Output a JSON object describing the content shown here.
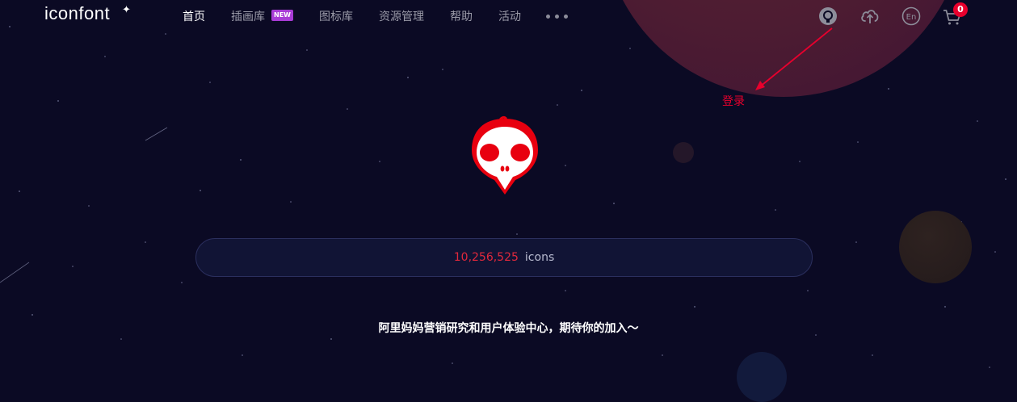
{
  "brand": {
    "logo_text": "iconfont",
    "logo_mark": "✦"
  },
  "nav": {
    "items": [
      {
        "label": "首页"
      },
      {
        "label": "插画库"
      },
      {
        "label": "图标库"
      },
      {
        "label": "资源管理"
      },
      {
        "label": "帮助"
      },
      {
        "label": "活动"
      }
    ],
    "new_badge": "NEW",
    "more_icon": "more-dots-icon"
  },
  "header_actions": {
    "icons": [
      "github-icon",
      "upload-cloud-icon",
      "language-en-icon",
      "cart-icon"
    ],
    "language_label": "En",
    "cart_count": "0"
  },
  "annotation": {
    "login_label": "登录"
  },
  "hero": {
    "icon_count": "10,256,525",
    "icon_unit": "icons",
    "tagline": "阿里妈妈营销研究和用户体验中心，期待你的加入～"
  },
  "colors": {
    "background": "#0b0a24",
    "accent": "#e8002d",
    "badge": "#a83bd6"
  }
}
